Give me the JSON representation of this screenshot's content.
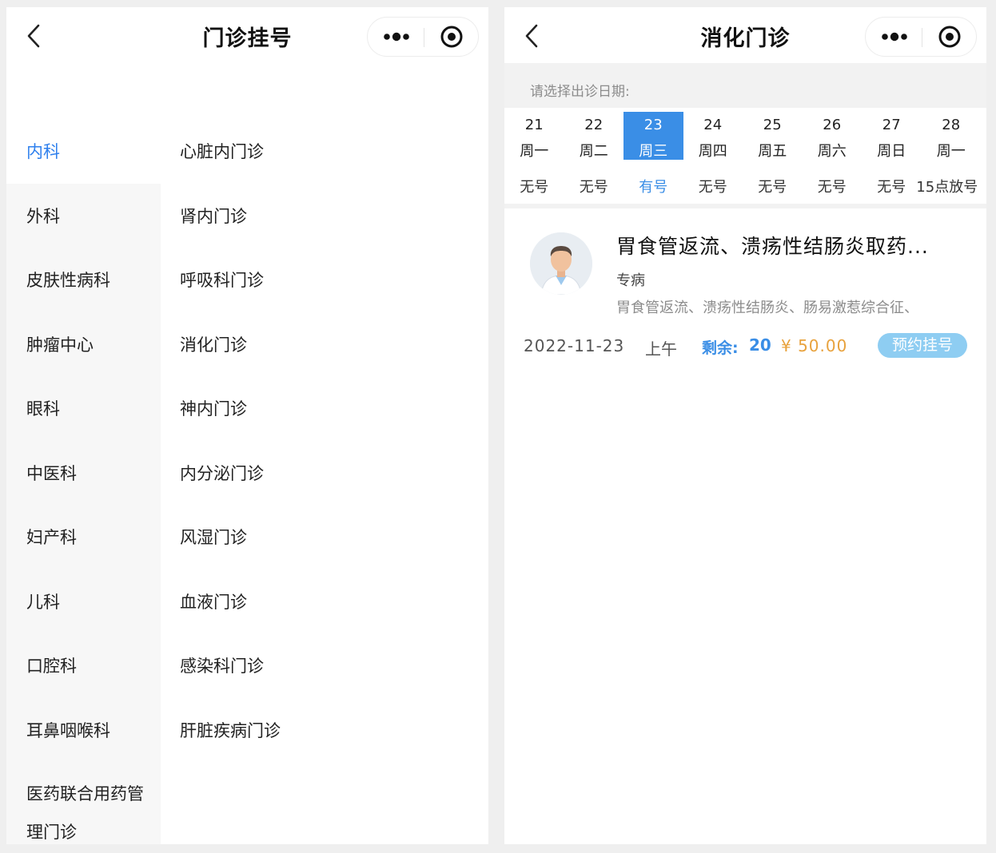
{
  "left": {
    "title": "门诊挂号",
    "departments": [
      "内科",
      "外科",
      "皮肤性病科",
      "肿瘤中心",
      "眼科",
      "中医科",
      "妇产科",
      "儿科",
      "口腔科",
      "耳鼻咽喉科",
      "医药联合用药管理门诊"
    ],
    "active_department": "内科",
    "clinics": [
      "心脏内门诊",
      "肾内门诊",
      "呼吸科门诊",
      "消化门诊",
      "神内门诊",
      "内分泌门诊",
      "风湿门诊",
      "血液门诊",
      "感染科门诊",
      "肝脏疾病门诊"
    ]
  },
  "right": {
    "title": "消化门诊",
    "date_hint": "请选择出诊日期:",
    "dates": [
      {
        "day": "21",
        "week": "周一",
        "status": "无号"
      },
      {
        "day": "22",
        "week": "周二",
        "status": "无号"
      },
      {
        "day": "23",
        "week": "周三",
        "status": "有号",
        "selected": true
      },
      {
        "day": "24",
        "week": "周四",
        "status": "无号"
      },
      {
        "day": "25",
        "week": "周五",
        "status": "无号"
      },
      {
        "day": "26",
        "week": "周六",
        "status": "无号"
      },
      {
        "day": "27",
        "week": "周日",
        "status": "无号"
      },
      {
        "day": "28",
        "week": "周一",
        "status": "15点放号"
      }
    ],
    "program": {
      "title": "胃食管返流、溃疡性结肠炎取药...",
      "type": "专病",
      "description": "胃食管返流、溃疡性结肠炎、肠易激惹综合征、",
      "date": "2022-11-23",
      "period": "上午",
      "remain_label": "剩余:",
      "remain": "20",
      "price": "¥ 50.00",
      "book_label": "预约挂号"
    }
  },
  "colors": {
    "accent": "#3a8ee6",
    "active_text": "#2f80ed",
    "price": "#e8a23d",
    "book_button": "#8ecdf2",
    "sidebar_bg": "#f7f7f7"
  },
  "icons": [
    "back-arrow-icon",
    "more-dots-icon",
    "record-circle-icon",
    "doctor-avatar"
  ]
}
